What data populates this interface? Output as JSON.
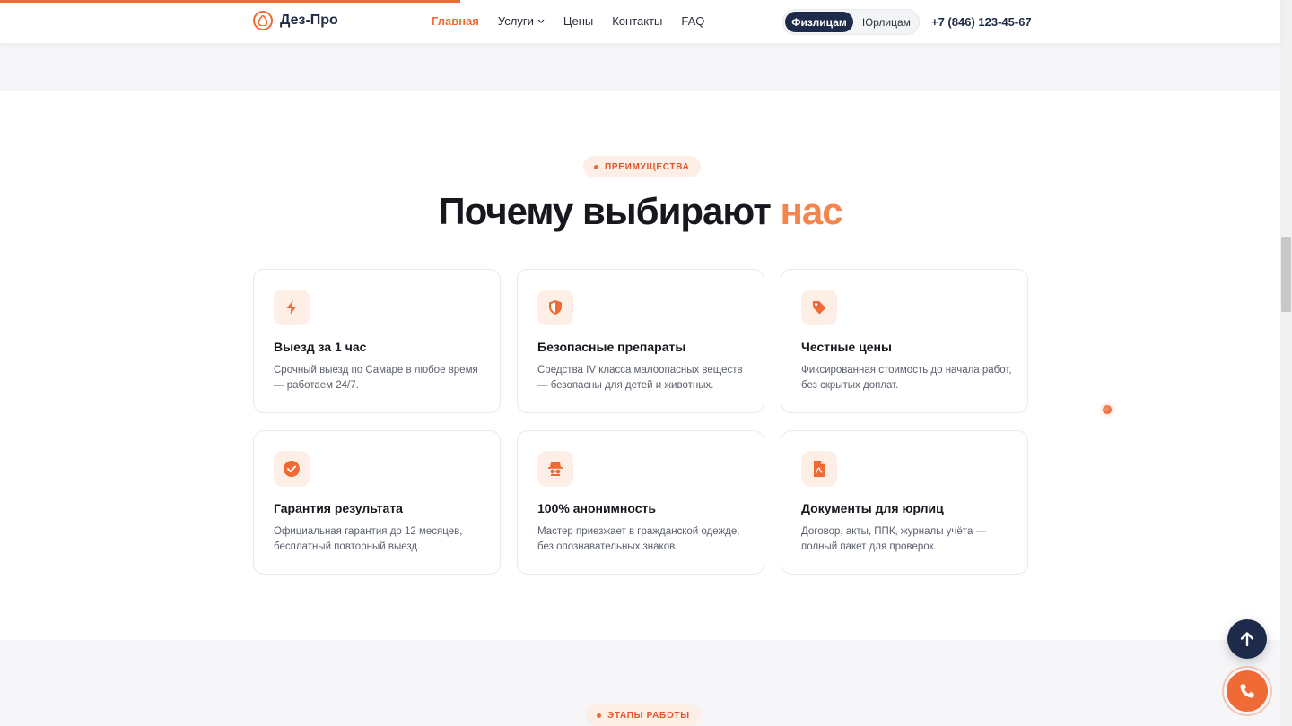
{
  "header": {
    "brand": "Дез-Про",
    "nav": [
      {
        "label": "Главная",
        "active": true
      },
      {
        "label": "Услуги",
        "dropdown": true
      },
      {
        "label": "Цены"
      },
      {
        "label": "Контакты"
      },
      {
        "label": "FAQ"
      }
    ],
    "audience": {
      "individuals": "Физлицам",
      "companies": "Юрлицам",
      "selected": "individuals"
    },
    "phone": "+7 (846) 123-45-67"
  },
  "advantages": {
    "badge": "ПРЕИМУЩЕСТВА",
    "title_main": "Почему выбирают",
    "title_accent": "нас",
    "cards": [
      {
        "icon": "lightning-icon",
        "title": "Выезд за 1 час",
        "text": "Срочный выезд по Самаре в любое время — работаем 24/7."
      },
      {
        "icon": "shield-icon",
        "title": "Безопасные препараты",
        "text": "Средства IV класса малоопасных веществ — безопасны для детей и животных."
      },
      {
        "icon": "tag-icon",
        "title": "Честные цены",
        "text": "Фиксированная стоимость до начала работ, без скрытых доплат."
      },
      {
        "icon": "check-circle-icon",
        "title": "Гарантия результата",
        "text": "Официальная гарантия до 12 месяцев, бесплатный повторный выезд."
      },
      {
        "icon": "incognito-icon",
        "title": "100% анонимность",
        "text": "Мастер приезжает в гражданской одежде, без опознавательных знаков."
      },
      {
        "icon": "document-icon",
        "title": "Документы для юрлиц",
        "text": "Договор, акты, ППК, журналы учёта — полный пакет для проверок."
      }
    ]
  },
  "next_section": {
    "badge": "ЭТАПЫ РАБОТЫ"
  },
  "colors": {
    "accent": "#f06a35",
    "navy": "#1e2a4a"
  }
}
